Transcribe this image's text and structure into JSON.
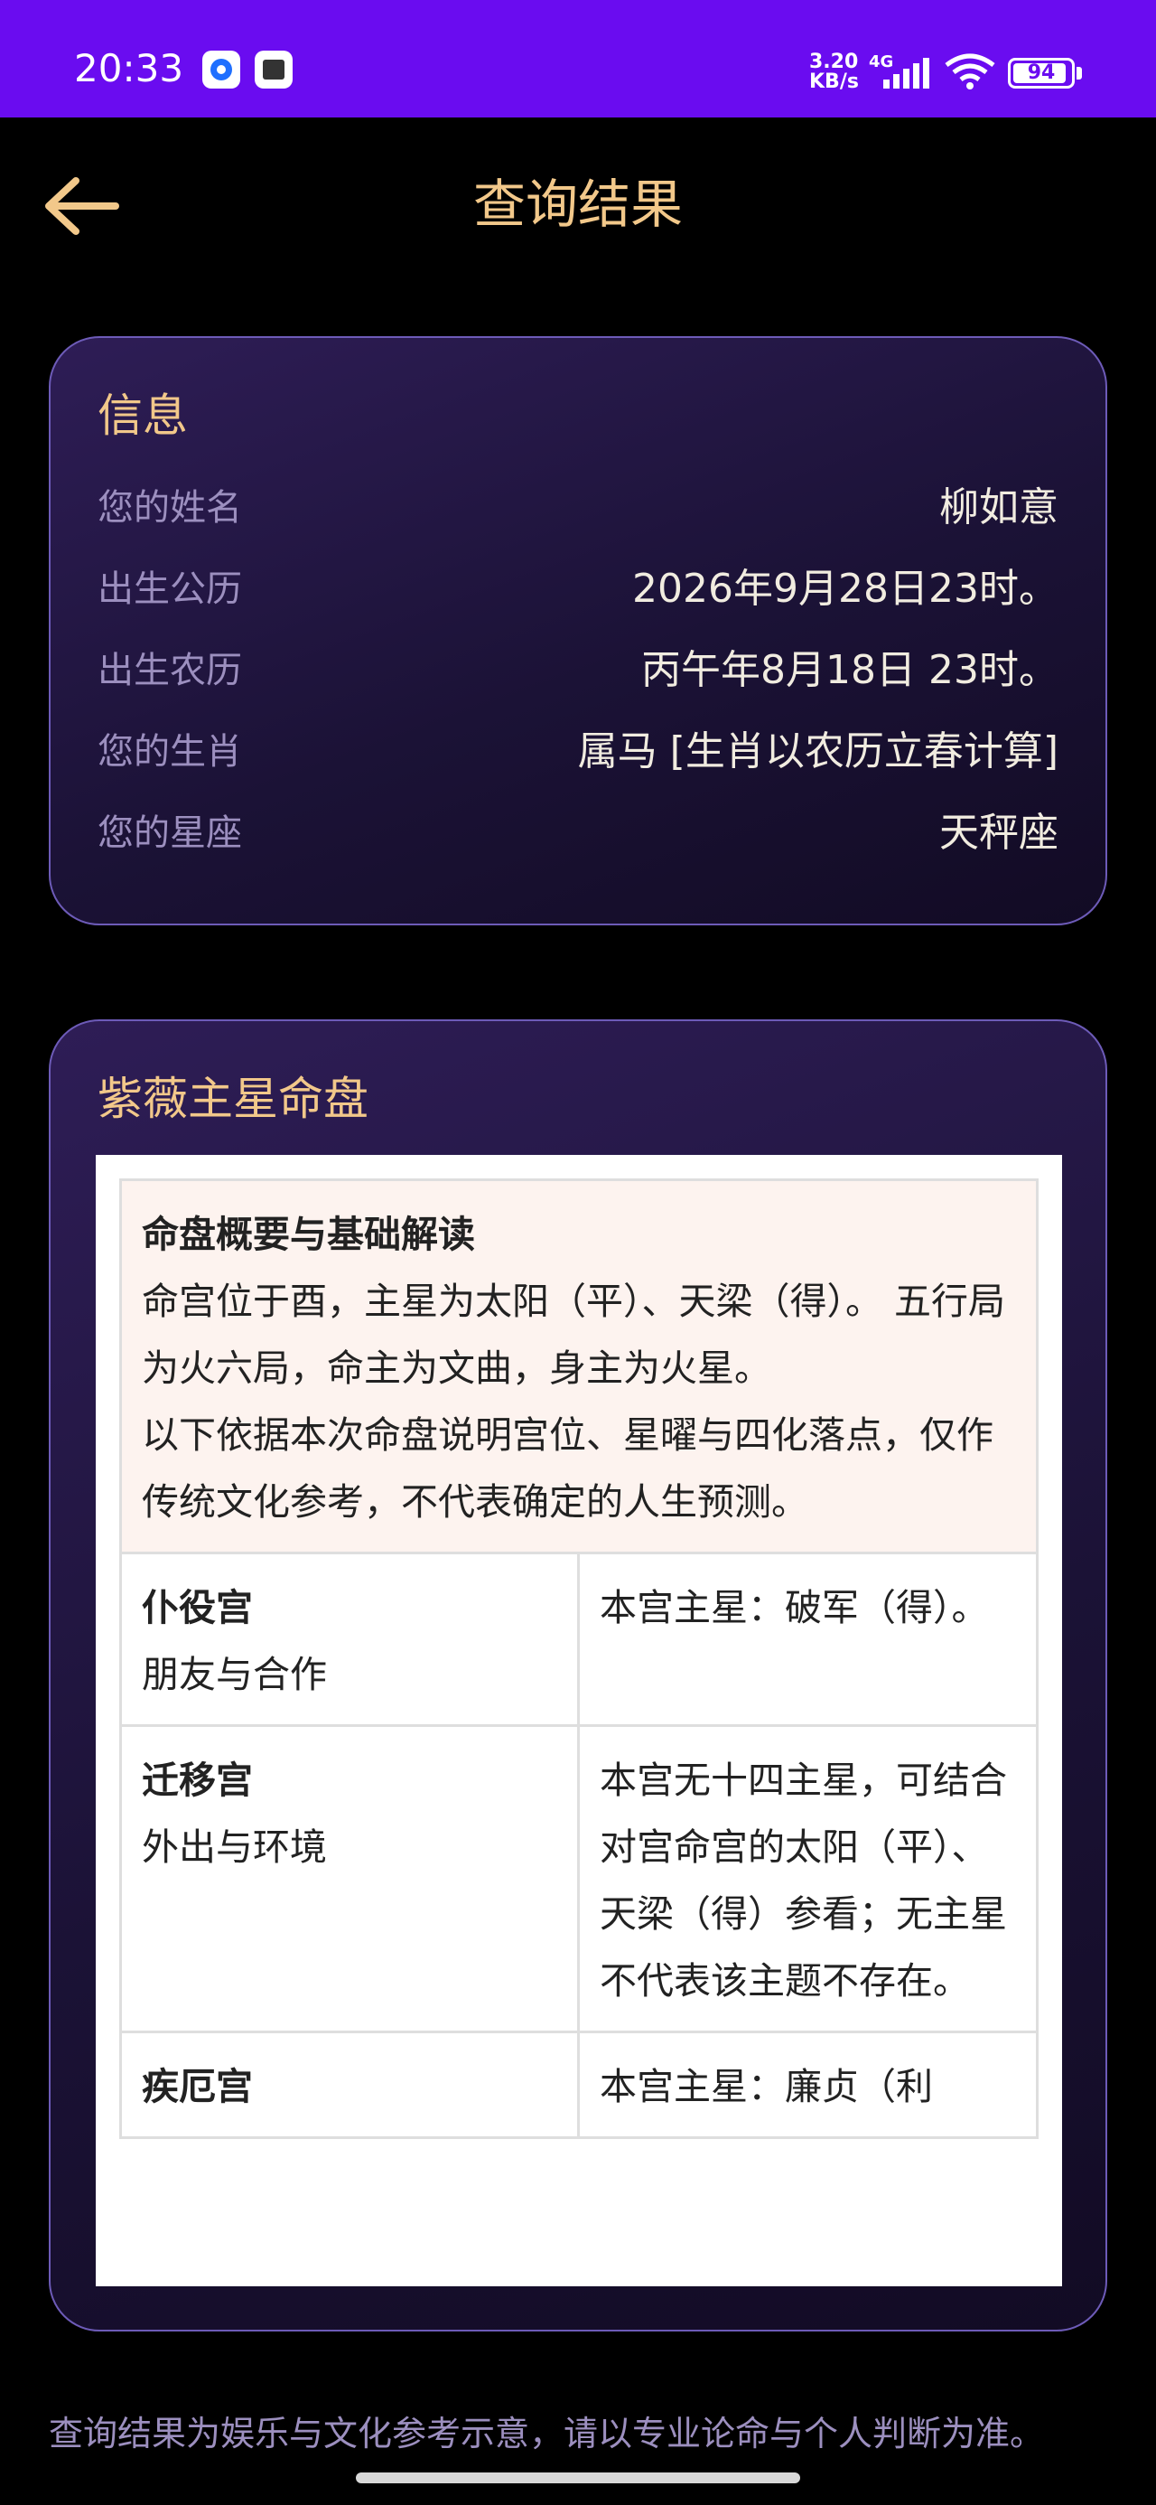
{
  "status_bar": {
    "time": "20:33",
    "net_speed": "3.20 KB/s",
    "net_type": "4G",
    "battery": "94",
    "battery_level": 0.94
  },
  "header": {
    "back_icon": "arrow-left-icon",
    "title": "查询结果"
  },
  "info_card": {
    "title": "信息",
    "rows": [
      {
        "label": "您的姓名",
        "value": "柳如意"
      },
      {
        "label": "出生公历",
        "value": "2026年9月28日23时。"
      },
      {
        "label": "出生农历",
        "value": "丙午年8月18日 23时。"
      },
      {
        "label": "您的生肖",
        "value": "属马 [生肖以农历立春计算]"
      },
      {
        "label": "您的星座",
        "value": "天秤座"
      }
    ]
  },
  "chart_card": {
    "title": "紫薇主星命盘",
    "summary": {
      "title": "命盘概要与基础解读",
      "line1": "命宫位于酉，主星为太阳（平）、天梁（得）。 五行局为火六局，命主为文曲，身主为火星。",
      "line2": "以下依据本次命盘说明宫位、星曜与四化落点，仅作传统文化参考，不代表确定的人生预测。"
    },
    "palaces": [
      {
        "name": "仆役宫",
        "topic": "朋友与合作",
        "desc": "本宫主星：破军（得）。"
      },
      {
        "name": "迁移宫",
        "topic": "外出与环境",
        "desc": "本宫无十四主星，可结合对宫命宫的太阳（平）、天梁（得）参看；无主星不代表该主题不存在。"
      },
      {
        "name": "疾厄宫",
        "topic": "",
        "desc": "本宫主星：廉贞（利"
      }
    ]
  },
  "footer": {
    "disclaimer": "查询结果为娱乐与文化参考示意，请以专业论命与个人判断为准。"
  }
}
